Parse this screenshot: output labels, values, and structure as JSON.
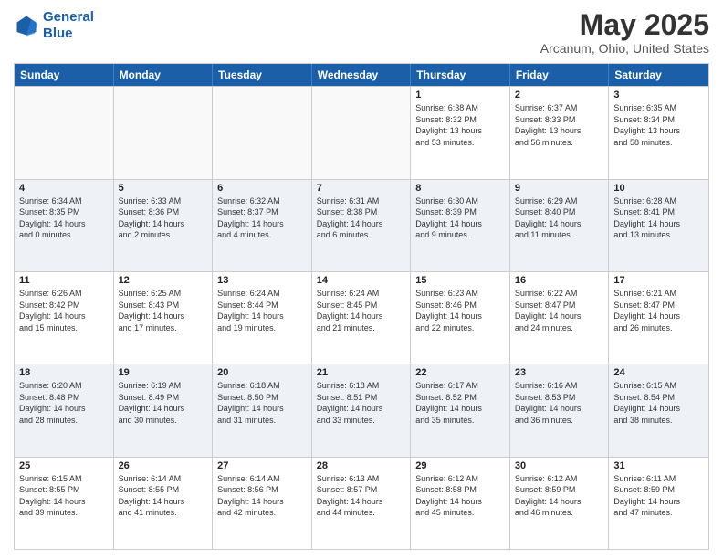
{
  "logo": {
    "line1": "General",
    "line2": "Blue"
  },
  "title": "May 2025",
  "subtitle": "Arcanum, Ohio, United States",
  "days_of_week": [
    "Sunday",
    "Monday",
    "Tuesday",
    "Wednesday",
    "Thursday",
    "Friday",
    "Saturday"
  ],
  "weeks": [
    [
      {
        "day": "",
        "info": ""
      },
      {
        "day": "",
        "info": ""
      },
      {
        "day": "",
        "info": ""
      },
      {
        "day": "",
        "info": ""
      },
      {
        "day": "1",
        "info": "Sunrise: 6:38 AM\nSunset: 8:32 PM\nDaylight: 13 hours\nand 53 minutes."
      },
      {
        "day": "2",
        "info": "Sunrise: 6:37 AM\nSunset: 8:33 PM\nDaylight: 13 hours\nand 56 minutes."
      },
      {
        "day": "3",
        "info": "Sunrise: 6:35 AM\nSunset: 8:34 PM\nDaylight: 13 hours\nand 58 minutes."
      }
    ],
    [
      {
        "day": "4",
        "info": "Sunrise: 6:34 AM\nSunset: 8:35 PM\nDaylight: 14 hours\nand 0 minutes."
      },
      {
        "day": "5",
        "info": "Sunrise: 6:33 AM\nSunset: 8:36 PM\nDaylight: 14 hours\nand 2 minutes."
      },
      {
        "day": "6",
        "info": "Sunrise: 6:32 AM\nSunset: 8:37 PM\nDaylight: 14 hours\nand 4 minutes."
      },
      {
        "day": "7",
        "info": "Sunrise: 6:31 AM\nSunset: 8:38 PM\nDaylight: 14 hours\nand 6 minutes."
      },
      {
        "day": "8",
        "info": "Sunrise: 6:30 AM\nSunset: 8:39 PM\nDaylight: 14 hours\nand 9 minutes."
      },
      {
        "day": "9",
        "info": "Sunrise: 6:29 AM\nSunset: 8:40 PM\nDaylight: 14 hours\nand 11 minutes."
      },
      {
        "day": "10",
        "info": "Sunrise: 6:28 AM\nSunset: 8:41 PM\nDaylight: 14 hours\nand 13 minutes."
      }
    ],
    [
      {
        "day": "11",
        "info": "Sunrise: 6:26 AM\nSunset: 8:42 PM\nDaylight: 14 hours\nand 15 minutes."
      },
      {
        "day": "12",
        "info": "Sunrise: 6:25 AM\nSunset: 8:43 PM\nDaylight: 14 hours\nand 17 minutes."
      },
      {
        "day": "13",
        "info": "Sunrise: 6:24 AM\nSunset: 8:44 PM\nDaylight: 14 hours\nand 19 minutes."
      },
      {
        "day": "14",
        "info": "Sunrise: 6:24 AM\nSunset: 8:45 PM\nDaylight: 14 hours\nand 21 minutes."
      },
      {
        "day": "15",
        "info": "Sunrise: 6:23 AM\nSunset: 8:46 PM\nDaylight: 14 hours\nand 22 minutes."
      },
      {
        "day": "16",
        "info": "Sunrise: 6:22 AM\nSunset: 8:47 PM\nDaylight: 14 hours\nand 24 minutes."
      },
      {
        "day": "17",
        "info": "Sunrise: 6:21 AM\nSunset: 8:47 PM\nDaylight: 14 hours\nand 26 minutes."
      }
    ],
    [
      {
        "day": "18",
        "info": "Sunrise: 6:20 AM\nSunset: 8:48 PM\nDaylight: 14 hours\nand 28 minutes."
      },
      {
        "day": "19",
        "info": "Sunrise: 6:19 AM\nSunset: 8:49 PM\nDaylight: 14 hours\nand 30 minutes."
      },
      {
        "day": "20",
        "info": "Sunrise: 6:18 AM\nSunset: 8:50 PM\nDaylight: 14 hours\nand 31 minutes."
      },
      {
        "day": "21",
        "info": "Sunrise: 6:18 AM\nSunset: 8:51 PM\nDaylight: 14 hours\nand 33 minutes."
      },
      {
        "day": "22",
        "info": "Sunrise: 6:17 AM\nSunset: 8:52 PM\nDaylight: 14 hours\nand 35 minutes."
      },
      {
        "day": "23",
        "info": "Sunrise: 6:16 AM\nSunset: 8:53 PM\nDaylight: 14 hours\nand 36 minutes."
      },
      {
        "day": "24",
        "info": "Sunrise: 6:15 AM\nSunset: 8:54 PM\nDaylight: 14 hours\nand 38 minutes."
      }
    ],
    [
      {
        "day": "25",
        "info": "Sunrise: 6:15 AM\nSunset: 8:55 PM\nDaylight: 14 hours\nand 39 minutes."
      },
      {
        "day": "26",
        "info": "Sunrise: 6:14 AM\nSunset: 8:55 PM\nDaylight: 14 hours\nand 41 minutes."
      },
      {
        "day": "27",
        "info": "Sunrise: 6:14 AM\nSunset: 8:56 PM\nDaylight: 14 hours\nand 42 minutes."
      },
      {
        "day": "28",
        "info": "Sunrise: 6:13 AM\nSunset: 8:57 PM\nDaylight: 14 hours\nand 44 minutes."
      },
      {
        "day": "29",
        "info": "Sunrise: 6:12 AM\nSunset: 8:58 PM\nDaylight: 14 hours\nand 45 minutes."
      },
      {
        "day": "30",
        "info": "Sunrise: 6:12 AM\nSunset: 8:59 PM\nDaylight: 14 hours\nand 46 minutes."
      },
      {
        "day": "31",
        "info": "Sunrise: 6:11 AM\nSunset: 8:59 PM\nDaylight: 14 hours\nand 47 minutes."
      }
    ]
  ],
  "colors": {
    "header_bg": "#1a5fa8",
    "row_alt": "#eef2f7",
    "row_normal": "#ffffff"
  }
}
